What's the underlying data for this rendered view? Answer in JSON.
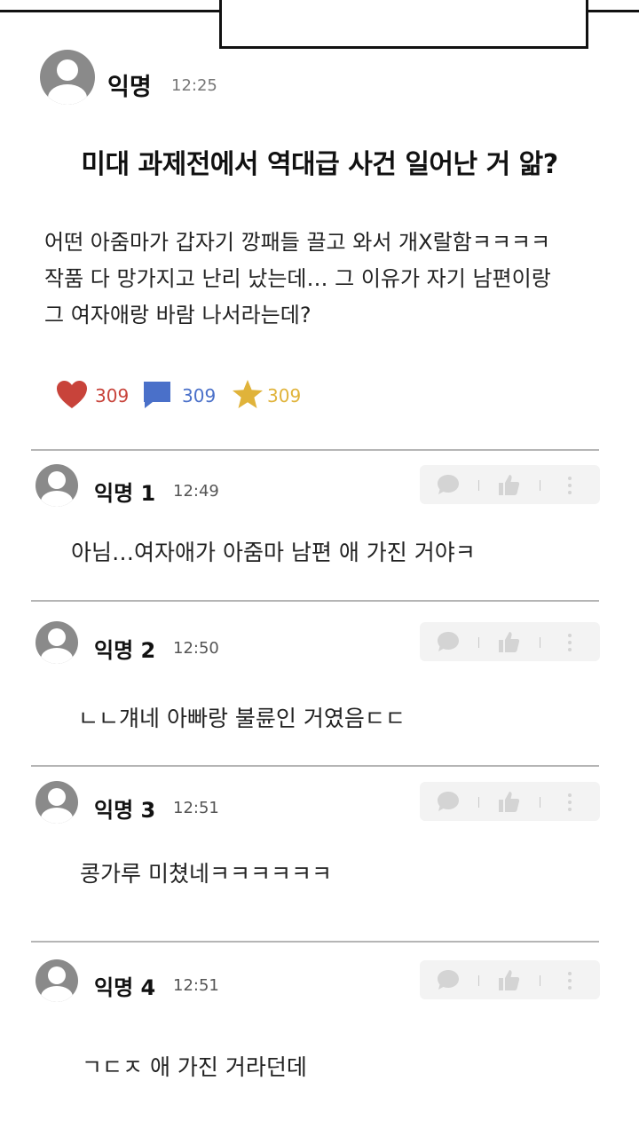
{
  "post": {
    "author": "익명",
    "time": "12:25",
    "title": "미대 과제전에서 역대급 사건 일어난 거 앎?",
    "body_lines": [
      "어떤 아줌마가 갑자기 깡패들 끌고 와서 개X랄함ㅋㅋㅋㅋ",
      "작품 다 망가지고 난리 났는데… 그 이유가 자기 남편이랑",
      "그 여자애랑 바람 나서라는데?"
    ],
    "stats": {
      "likes": "309",
      "comments": "309",
      "stars": "309"
    },
    "icons": [
      "heart-icon",
      "comment-icon",
      "star-icon"
    ]
  },
  "comments": [
    {
      "author": "익명 1",
      "time": "12:49",
      "text": "아님…여자애가 아줌마 남편 애 가진 거야ㅋ"
    },
    {
      "author": "익명 2",
      "time": "12:50",
      "text": "ㄴㄴ걔네 아빠랑 불륜인 거였음ㄷㄷ"
    },
    {
      "author": "익명 3",
      "time": "12:51",
      "text": "콩가루 미쳤네ㅋㅋㅋㅋㅋㅋ"
    },
    {
      "author": "익명 4",
      "time": "12:51",
      "text": "ㄱㄷㅈ 애 가진 거라던데"
    }
  ],
  "colors": {
    "like": "#c8433a",
    "comment": "#4a70c9",
    "star": "#e0b33a",
    "avatar": "#8a8a8a"
  }
}
